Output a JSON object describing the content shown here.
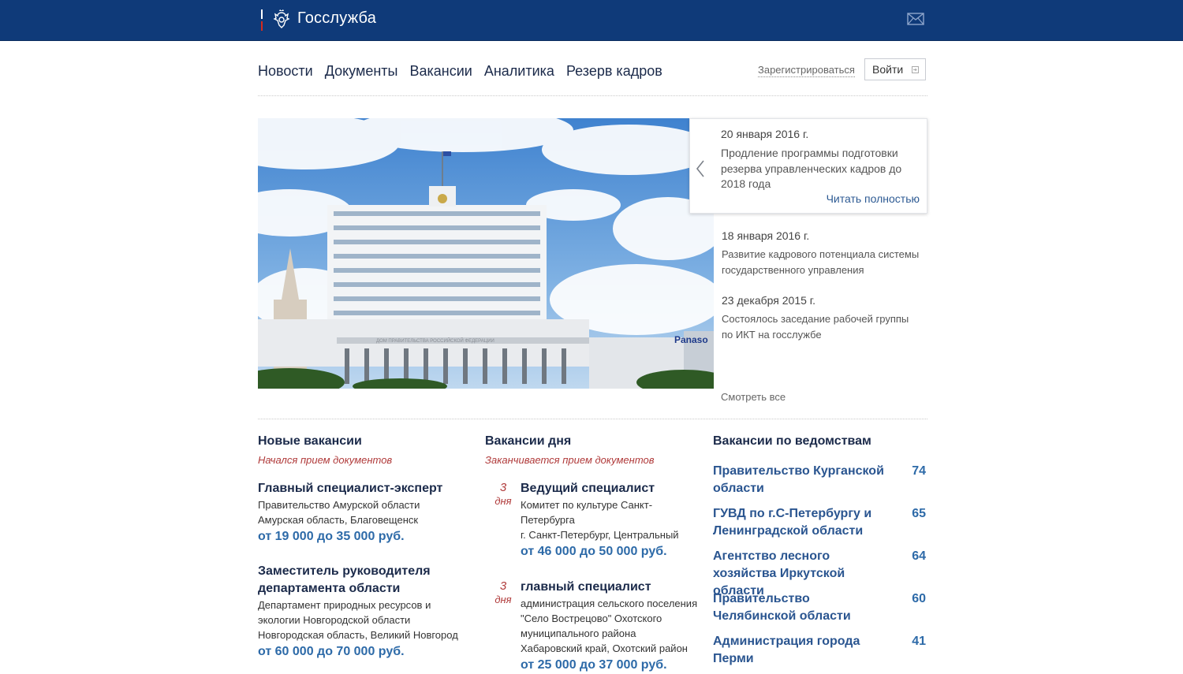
{
  "header": {
    "site_title": "Госслужба",
    "brand_color": "#0f3a79"
  },
  "nav": {
    "items": [
      "Новости",
      "Документы",
      "Вакансии",
      "Аналитика",
      "Резерв кадров"
    ],
    "register_label": "Зарегистрироваться",
    "login_label": "Войти"
  },
  "news": {
    "featured": {
      "date": "20 января 2016 г.",
      "text": "Продление программы подготовки резерва управленческих кадров до 2018 года",
      "read_more": "Читать полностью"
    },
    "items": [
      {
        "date": "18 января 2016 г.",
        "text": "Развитие кадрового потенциала системы государственного управления"
      },
      {
        "date": "23 декабря 2015 г.",
        "text": "Состоялось заседание рабочей группы по ИКТ на госслужбе"
      }
    ],
    "see_all": "Смотреть все",
    "image_caption": "ДОМ ПРАВИТЕЛЬСТВА РОССИЙСКОЙ ФЕДЕРАЦИИ",
    "image_sign": "Panaso"
  },
  "new_vacancies": {
    "title": "Новые вакансии",
    "subtitle": "Начался прием документов",
    "items": [
      {
        "title": "Главный специалист-эксперт",
        "lines": [
          "Правительство Амурской области",
          "Амурская область, Благовещенск"
        ],
        "salary": "от 19 000 до 35 000 руб."
      },
      {
        "title": "Заместитель руководителя департамента области",
        "lines": [
          "Департамент природных ресурсов и экологии Новгородской области",
          "Новгородская область, Великий Новгород"
        ],
        "salary": "от 60 000 до 70 000 руб."
      }
    ]
  },
  "day_vacancies": {
    "title": "Вакансии дня",
    "subtitle": "Заканчивается прием документов",
    "items": [
      {
        "days": "3",
        "days_unit": "дня",
        "title": "Ведущий специалист",
        "lines": [
          "Комитет по культуре Санкт-Петербурга",
          "г. Санкт-Петербург, Центральный"
        ],
        "salary": "от 46 000 до 50 000 руб."
      },
      {
        "days": "3",
        "days_unit": "дня",
        "title": "главный специалист",
        "lines": [
          "администрация сельского поселения \"Село Вострецово\" Охотского муниципального района",
          "Хабаровский край, Охотский район"
        ],
        "salary": "от 25 000 до 37 000 руб."
      }
    ]
  },
  "departments": {
    "title": "Вакансии по ведомствам",
    "items": [
      {
        "name": "Правительство Курганской области",
        "count": "74"
      },
      {
        "name": "ГУВД по г.С-Петербургу и Ленинградской области",
        "count": "65"
      },
      {
        "name": "Агентство лесного хозяйства Иркутской области",
        "count": "64"
      },
      {
        "name": "Правительство Челябинской области",
        "count": "60"
      },
      {
        "name": "Администрация города Перми",
        "count": "41"
      }
    ]
  }
}
